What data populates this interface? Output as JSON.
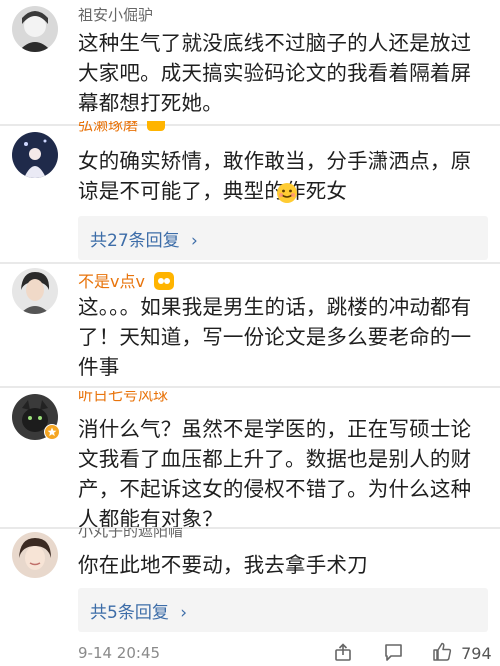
{
  "comments": [
    {
      "name": "祖安小倔驴",
      "text": "这种生气了就没底线不过脑子的人还是放过大家吧。成天搞实验码论文的我看着隔着屏幕都想打死她。"
    },
    {
      "name": "弘濑琢磨",
      "text": "女的确实矫情，敢作敢当，分手潇洒点，原谅是不可能了，典型的作死女",
      "reply_label": "共27条回复"
    },
    {
      "name": "不是v点v",
      "text": "这。。。如果我是男生的话，跳楼的冲动都有了！天知道，写一份论文是多么要老命的一件事"
    },
    {
      "name": "听日七号风球",
      "text": "消什么气？虽然不是学医的，正在写硕士论文我看了血压都上升了。数据也是别人的财产，不起诉这女的侵权不错了。为什么这种人都能有对象？"
    },
    {
      "name": "小丸子的遮阳帽",
      "text": "你在此地不要动，我去拿手术刀",
      "reply_label": "共5条回复"
    }
  ],
  "footer": {
    "time": "9-14 20:45",
    "likes": "794"
  },
  "colors": {
    "reply_link": "#3d6da8",
    "vip_name": "#e8740c"
  }
}
